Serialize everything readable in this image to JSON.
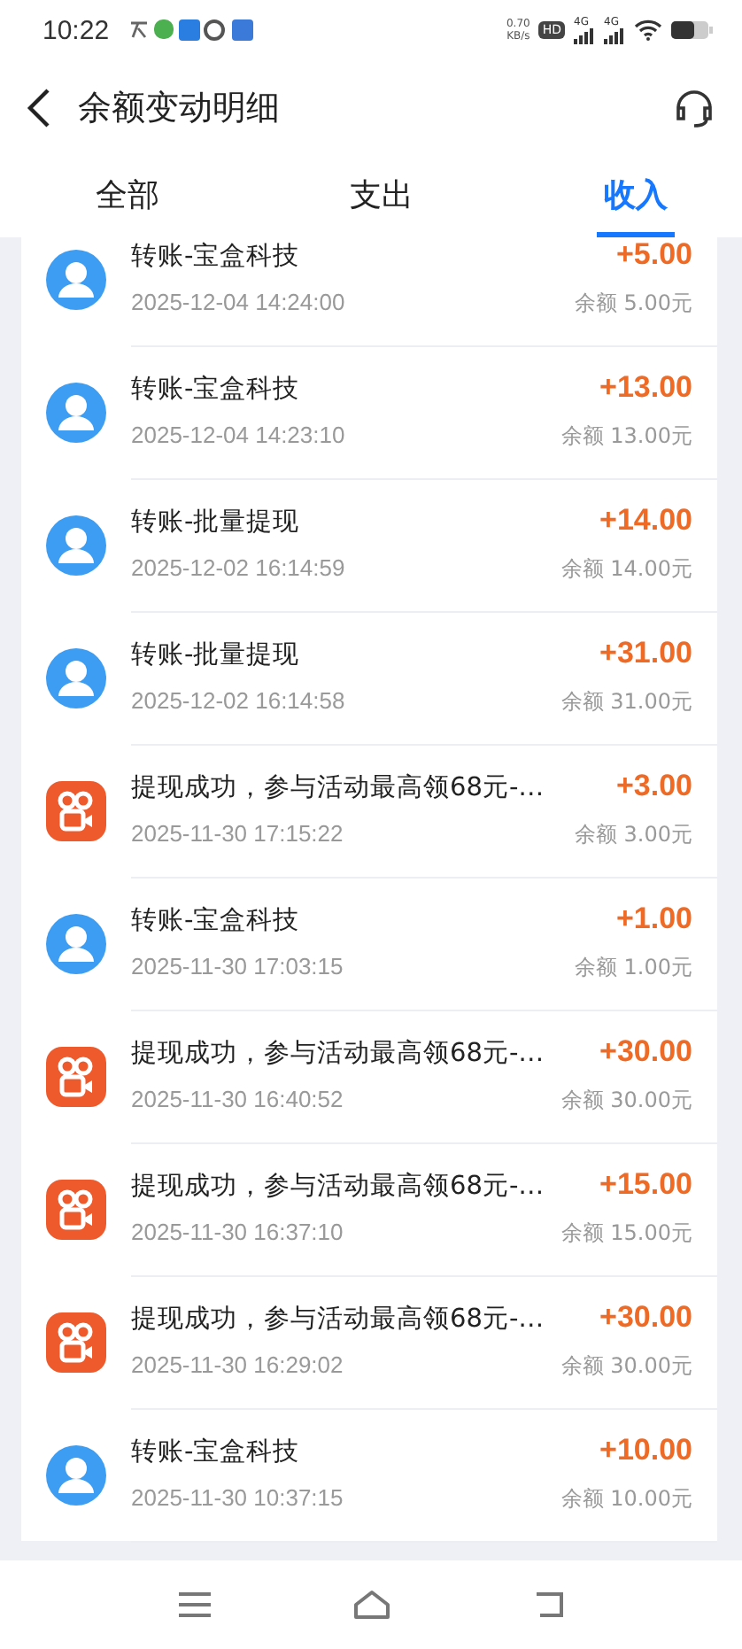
{
  "status_bar": {
    "time": "10:22",
    "speed": "0.70",
    "speed_unit": "KB/s",
    "hd": "HD",
    "networks": [
      "4G",
      "4G"
    ]
  },
  "header": {
    "title": "余额变动明细"
  },
  "tabs": [
    {
      "label": "全部",
      "selected": false
    },
    {
      "label": "支出",
      "selected": false
    },
    {
      "label": "收入",
      "selected": true
    }
  ],
  "transactions": [
    {
      "kind": "person",
      "title": "转账-宝盒科技",
      "time": "2025-12-04 14:24:00",
      "amount": "+5.00",
      "balance": "余额 5.00元"
    },
    {
      "kind": "person",
      "title": "转账-宝盒科技",
      "time": "2025-12-04 14:23:10",
      "amount": "+13.00",
      "balance": "余额 13.00元"
    },
    {
      "kind": "person",
      "title": "转账-批量提现",
      "time": "2025-12-02 16:14:59",
      "amount": "+14.00",
      "balance": "余额 14.00元"
    },
    {
      "kind": "person",
      "title": "转账-批量提现",
      "time": "2025-12-02 16:14:58",
      "amount": "+31.00",
      "balance": "余额 31.00元"
    },
    {
      "kind": "app",
      "title": "提现成功，参与活动最高领68元-…",
      "time": "2025-11-30 17:15:22",
      "amount": "+3.00",
      "balance": "余额 3.00元"
    },
    {
      "kind": "person",
      "title": "转账-宝盒科技",
      "time": "2025-11-30 17:03:15",
      "amount": "+1.00",
      "balance": "余额 1.00元"
    },
    {
      "kind": "app",
      "title": "提现成功，参与活动最高领68元-…",
      "time": "2025-11-30 16:40:52",
      "amount": "+30.00",
      "balance": "余额 30.00元"
    },
    {
      "kind": "app",
      "title": "提现成功，参与活动最高领68元-…",
      "time": "2025-11-30 16:37:10",
      "amount": "+15.00",
      "balance": "余额 15.00元"
    },
    {
      "kind": "app",
      "title": "提现成功，参与活动最高领68元-…",
      "time": "2025-11-30 16:29:02",
      "amount": "+30.00",
      "balance": "余额 30.00元"
    },
    {
      "kind": "person",
      "title": "转账-宝盒科技",
      "time": "2025-11-30 10:37:15",
      "amount": "+10.00",
      "balance": "余额 10.00元"
    }
  ]
}
